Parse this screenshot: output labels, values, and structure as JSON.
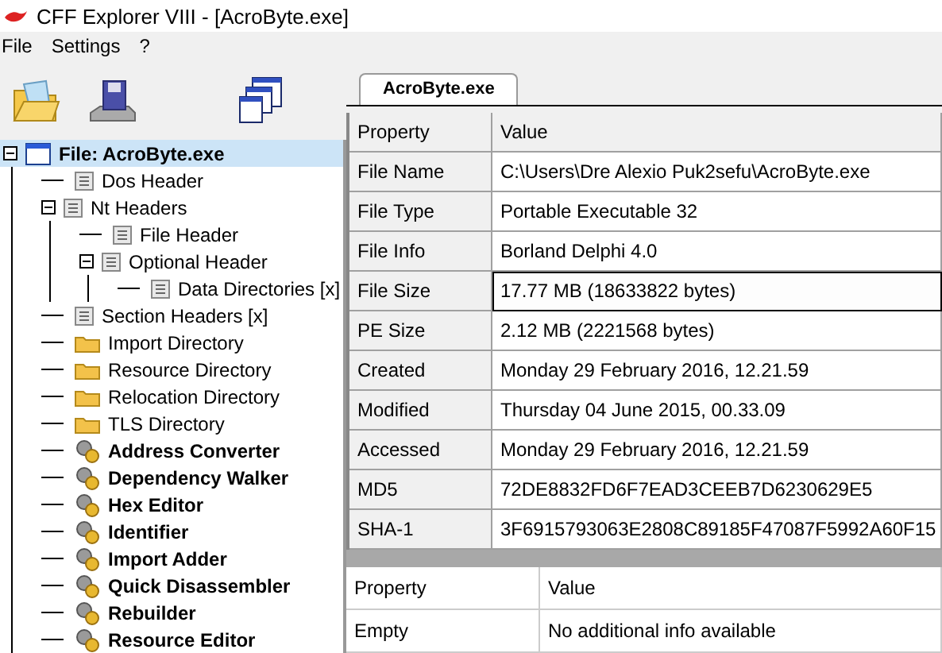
{
  "window": {
    "title": "CFF Explorer VIII - [AcroByte.exe]"
  },
  "menu": [
    "File",
    "Settings",
    "?"
  ],
  "tree": [
    {
      "label": "File: AcroByte.exe",
      "kind": "file",
      "selected": true,
      "expanded": true,
      "children": [
        {
          "label": "Dos Header",
          "kind": "doc",
          "selected": false
        },
        {
          "label": "Nt Headers",
          "kind": "doc",
          "selected": false,
          "expanded": true,
          "children": [
            {
              "label": "File Header",
              "kind": "doc",
              "selected": false
            },
            {
              "label": "Optional Header",
              "kind": "doc",
              "selected": false,
              "expanded": true,
              "children": [
                {
                  "label": "Data Directories [x]",
                  "kind": "doc",
                  "selected": false
                }
              ]
            }
          ]
        },
        {
          "label": "Section Headers [x]",
          "kind": "doc",
          "selected": false
        },
        {
          "label": "Import Directory",
          "kind": "folder",
          "selected": false
        },
        {
          "label": "Resource Directory",
          "kind": "folder",
          "selected": false
        },
        {
          "label": "Relocation Directory",
          "kind": "folder",
          "selected": false
        },
        {
          "label": "TLS Directory",
          "kind": "folder",
          "selected": false
        },
        {
          "label": "Address Converter",
          "kind": "tool",
          "selected": false
        },
        {
          "label": "Dependency Walker",
          "kind": "tool",
          "selected": false
        },
        {
          "label": "Hex Editor",
          "kind": "tool",
          "selected": false
        },
        {
          "label": "Identifier",
          "kind": "tool",
          "selected": false
        },
        {
          "label": "Import Adder",
          "kind": "tool",
          "selected": false
        },
        {
          "label": "Quick Disassembler",
          "kind": "tool",
          "selected": false
        },
        {
          "label": "Rebuilder",
          "kind": "tool",
          "selected": false
        },
        {
          "label": "Resource Editor",
          "kind": "tool",
          "selected": false
        }
      ]
    }
  ],
  "tabs": [
    {
      "label": "AcroByte.exe",
      "selected": true
    }
  ],
  "table": {
    "columns": [
      "Property",
      "Value"
    ],
    "rows": [
      {
        "property": "File Name",
        "value": "C:\\Users\\Dre Alexio Puk2sefu\\AcroByte.exe",
        "selected": false
      },
      {
        "property": "File Type",
        "value": "Portable Executable 32",
        "selected": false
      },
      {
        "property": "File Info",
        "value": "Borland Delphi 4.0",
        "selected": false
      },
      {
        "property": "File Size",
        "value": "17.77 MB (18633822 bytes)",
        "selected": true
      },
      {
        "property": "PE Size",
        "value": "2.12 MB (2221568 bytes)",
        "selected": false
      },
      {
        "property": "Created",
        "value": "Monday 29 February 2016, 12.21.59",
        "selected": false
      },
      {
        "property": "Modified",
        "value": "Thursday 04 June 2015, 00.33.09",
        "selected": false
      },
      {
        "property": "Accessed",
        "value": "Monday 29 February 2016, 12.21.59",
        "selected": false
      },
      {
        "property": "MD5",
        "value": "72DE8832FD6F7EAD3CEEB7D6230629E5",
        "selected": false
      },
      {
        "property": "SHA-1",
        "value": "3F6915793063E2808C89185F47087F5992A60F15",
        "selected": false
      }
    ]
  },
  "info_table": {
    "columns": [
      "Property",
      "Value"
    ],
    "rows": [
      {
        "property": "Empty",
        "value": "No additional info available"
      }
    ]
  }
}
